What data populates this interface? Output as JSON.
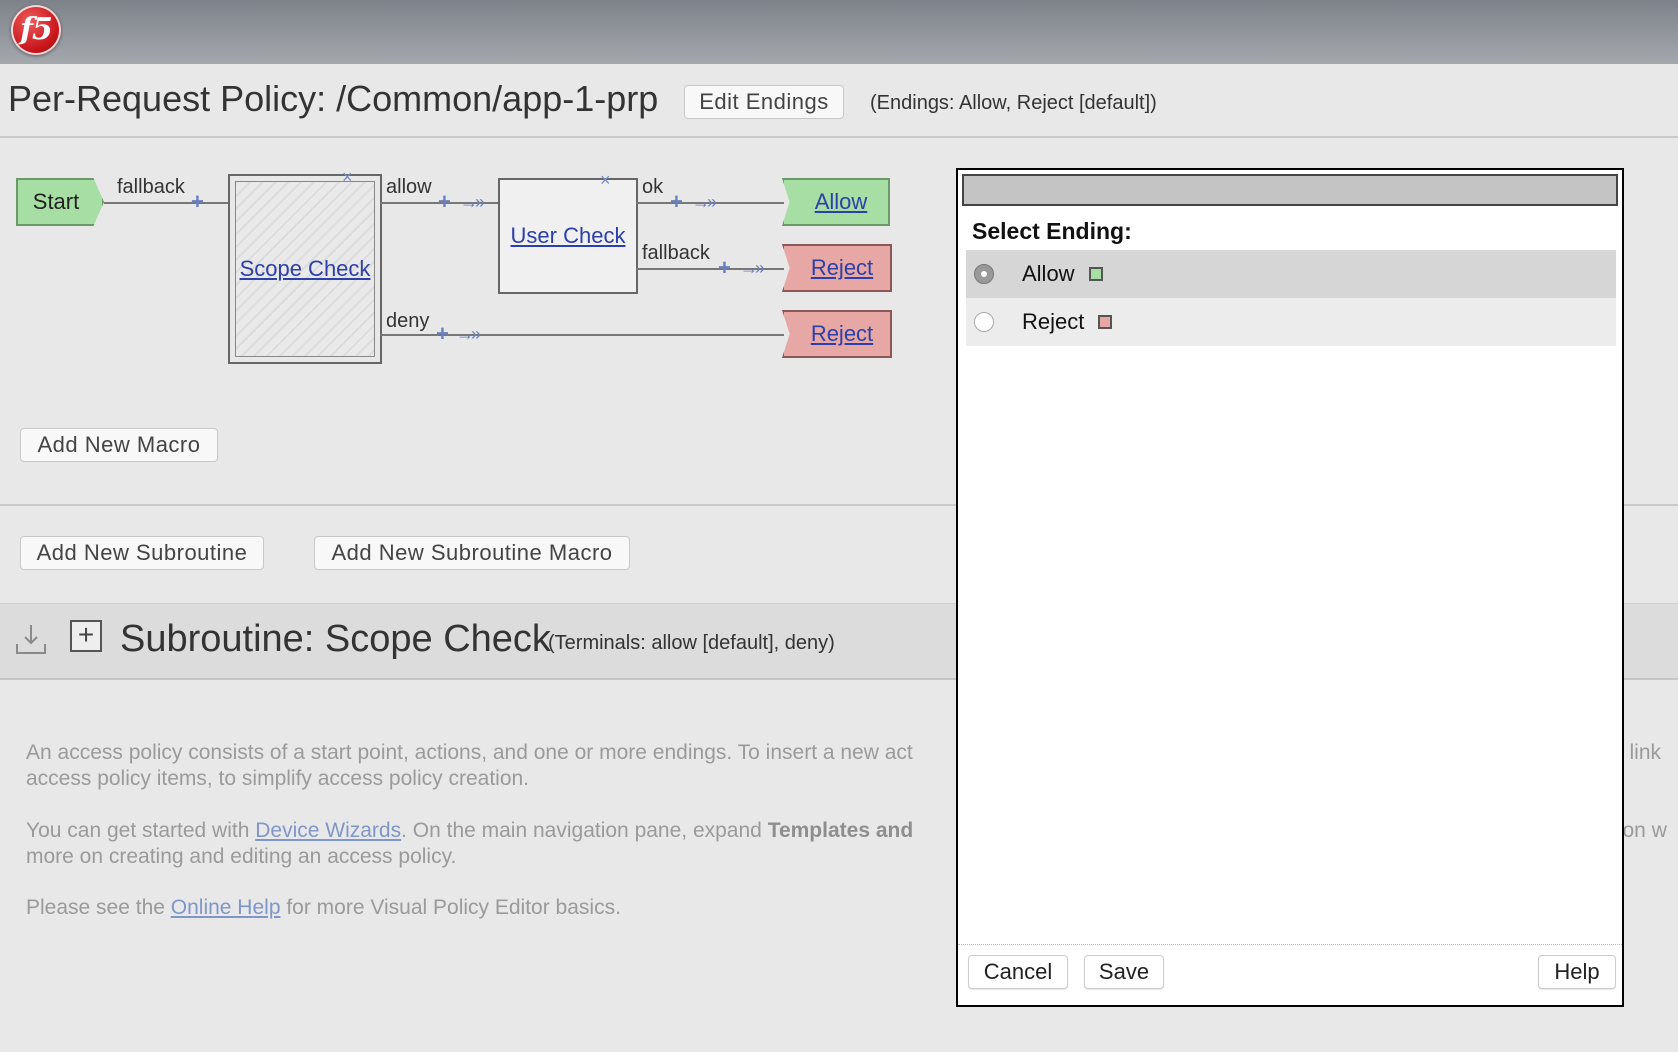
{
  "app": {
    "logo_text": "f5"
  },
  "policy": {
    "title": "Per-Request Policy: /Common/app-1-prp",
    "edit_endings_label": "Edit Endings",
    "endings_note": "(Endings: Allow, Reject [default])"
  },
  "flow": {
    "start_label": "Start",
    "fallback_label": "fallback",
    "scope_check_label": "Scope Check",
    "allow_label": "allow",
    "deny_label": "deny",
    "user_check_label": "User Check",
    "ok_label": "ok",
    "user_fallback_label": "fallback",
    "ending_allow": "Allow",
    "ending_reject_1": "Reject",
    "ending_reject_2": "Reject",
    "remove_glyph": "×",
    "add_glyph": "+",
    "arrow_glyph": "→»"
  },
  "buttons": {
    "add_new_macro": "Add New Macro",
    "add_new_subroutine": "Add New Subroutine",
    "add_new_subroutine_macro": "Add New Subroutine Macro"
  },
  "subroutine": {
    "title": "Subroutine: Scope Check",
    "terminals_note": "(Terminals: allow [default], deny)",
    "expand_glyph": "+"
  },
  "help": {
    "line1a": "An access policy consists of a start point, actions, and one or more endings. To insert a new act",
    "line1b": "e link",
    "line2": "access policy items, to simplify access policy creation.",
    "line3_pre": "You can get started with ",
    "line3_link": "Device Wizards",
    "line3_mid": ". On the main navigation pane, expand ",
    "line3_bold": "Templates and",
    "line3_end": "tion w",
    "line4": "more on creating and editing an access policy.",
    "line5_pre": "Please see the ",
    "line5_link": "Online Help",
    "line5_post": " for more Visual Policy Editor basics."
  },
  "dialog": {
    "heading": "Select Ending:",
    "options": [
      {
        "label": "Allow",
        "selected": true,
        "color": "#a6dea4"
      },
      {
        "label": "Reject",
        "selected": false,
        "color": "#e6a7a5"
      }
    ],
    "cancel_label": "Cancel",
    "save_label": "Save",
    "help_label": "Help"
  },
  "colors": {
    "allow": "#a6dea4",
    "reject": "#e6a7a5",
    "link": "#2d3fa8",
    "accent_blue": "#6a7fc0"
  },
  "icons": {
    "logo": "f5-logo-icon",
    "subroutine_tree": "subroutine-tree-icon",
    "expand": "expand-plus-icon"
  }
}
